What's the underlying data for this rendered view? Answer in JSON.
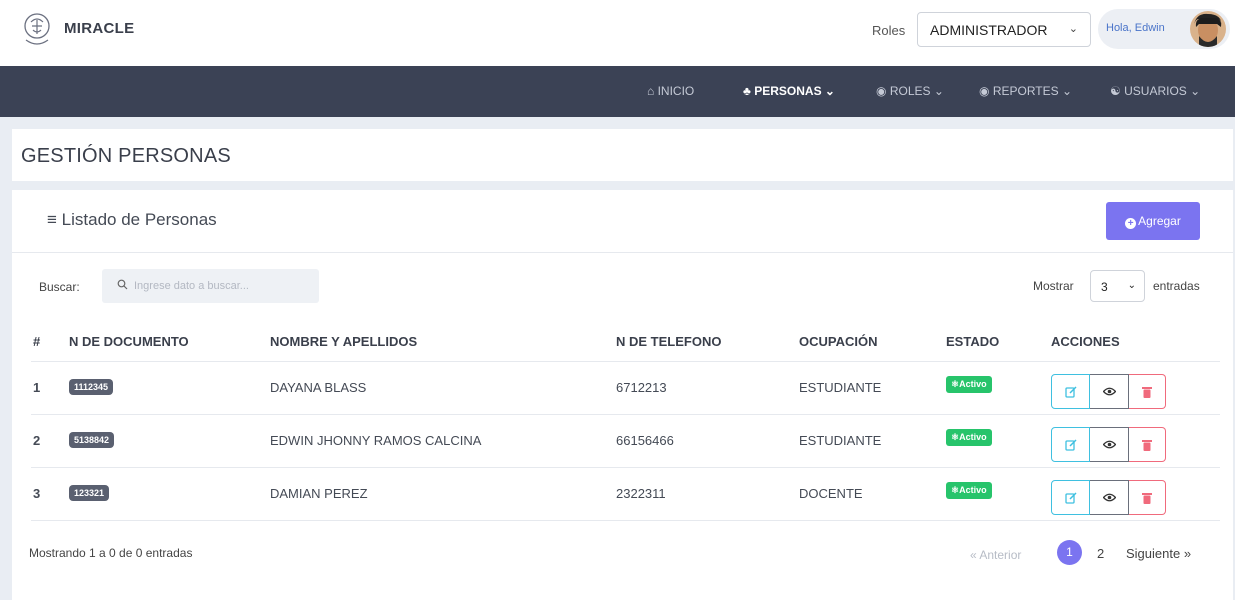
{
  "app": {
    "brand": "MIRACLE"
  },
  "header": {
    "roles_label": "Roles",
    "role_selected": "ADMINISTRADOR",
    "greeting": "Hola, Edwin"
  },
  "nav": {
    "items": [
      {
        "label": "INICIO",
        "icon": "home-icon"
      },
      {
        "label": "PERSONAS",
        "icon": "people-icon",
        "active": true
      },
      {
        "label": "ROLES",
        "icon": "roles-icon"
      },
      {
        "label": "REPORTES",
        "icon": "reports-icon"
      },
      {
        "label": "USUARIOS",
        "icon": "users-icon"
      }
    ]
  },
  "page": {
    "title": "GESTIÓN PERSONAS"
  },
  "list": {
    "title": "Listado de Personas",
    "add_label": "Agregar",
    "search_label": "Buscar:",
    "search_placeholder": "Ingrese dato a buscar...",
    "show_label": "Mostrar",
    "show_value": "3",
    "show_suffix": "entradas",
    "columns": [
      "#",
      "N DE DOCUMENTO",
      "NOMBRE Y APELLIDOS",
      "N DE TELEFONO",
      "OCUPACIÓN",
      "ESTADO",
      "ACCIONES"
    ],
    "rows": [
      {
        "num": "1",
        "doc": "1112345",
        "name": "DAYANA BLASS",
        "phone": "6712213",
        "occupation": "ESTUDIANTE",
        "status": "Activo"
      },
      {
        "num": "2",
        "doc": "5138842",
        "name": "EDWIN JHONNY RAMOS CALCINA",
        "phone": "66156466",
        "occupation": "ESTUDIANTE",
        "status": "Activo"
      },
      {
        "num": "3",
        "doc": "123321",
        "name": "DAMIAN PEREZ",
        "phone": "2322311",
        "occupation": "DOCENTE",
        "status": "Activo"
      }
    ],
    "info": "Mostrando 1 a 0 de 0 entradas",
    "pagination": {
      "prev": "« Anterior",
      "pages": [
        "1",
        "2"
      ],
      "current": "1",
      "next": "Siguiente »"
    }
  },
  "colors": {
    "navbar": "#3b4255",
    "accent": "#7b74f0",
    "status_active": "#27c46b",
    "doc_badge": "#5a6070",
    "edit": "#3fc0e0",
    "delete": "#f06a7c"
  }
}
